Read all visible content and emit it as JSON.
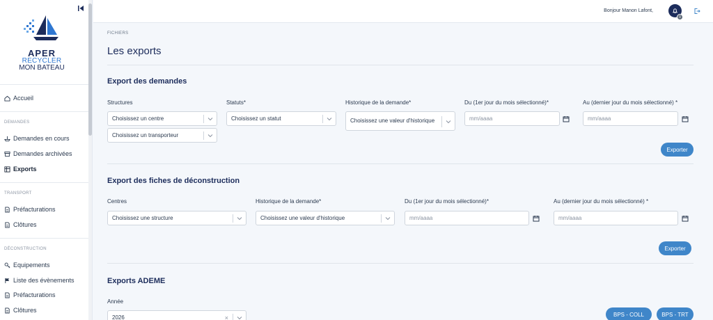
{
  "sidebar": {
    "brand": {
      "line1": "APER",
      "line2": "RECYCLER",
      "line3": "MON BATEAU"
    },
    "items": [
      {
        "label": "Accueil",
        "icon": "home-icon"
      },
      {
        "label": "Demandes en cours",
        "icon": "boat-icon"
      },
      {
        "label": "Demandes archivées",
        "icon": "archive-icon"
      },
      {
        "label": "Exports",
        "icon": "table-icon"
      },
      {
        "label": "Préfacturations",
        "icon": "document-icon"
      },
      {
        "label": "Clôtures",
        "icon": "document-icon"
      },
      {
        "label": "Equipements",
        "icon": "key-icon"
      },
      {
        "label": "Liste des évènements",
        "icon": "flag-icon"
      },
      {
        "label": "Préfacturations",
        "icon": "document-icon"
      },
      {
        "label": "Clôtures",
        "icon": "document-icon"
      }
    ],
    "sections": {
      "demandes": "DEMANDES",
      "transport": "TRANSPORT",
      "deconstruction": "DÉCONSTRUCTION"
    }
  },
  "header": {
    "greeting": "Bonjour Manon Lafont,",
    "notification_count": "0"
  },
  "page": {
    "breadcrumb": "FICHIERS",
    "title": "Les exports"
  },
  "export_demandes": {
    "title": "Export des demandes",
    "structures_label": "Structures",
    "centre_placeholder": "Choisissez un centre",
    "transporteur_placeholder": "Choisissez un transporteur",
    "statuts_label": "Statuts*",
    "statut_placeholder": "Choisissez un statut",
    "historique_label": "Historique de la demande*",
    "historique_placeholder": "Choisissez une valeur d'historique",
    "du_label": "Du (1er jour du mois sélectionné)*",
    "au_label": "Au (dernier jour du mois sélectionné) *",
    "date_placeholder": "mm/aaaa",
    "button": "Exporter"
  },
  "export_fiches": {
    "title": "Export des fiches de déconstruction",
    "centres_label": "Centres",
    "structure_placeholder": "Choisissez une structure",
    "historique_label": "Historique de la demande*",
    "historique_placeholder": "Choisissez une valeur d'historique",
    "du_label": "Du (1er jour du mois sélectionné)*",
    "au_label": "Au (dernier jour du mois sélectionné) *",
    "date_placeholder": "mm/aaaa",
    "button": "Exporter"
  },
  "export_ademe": {
    "title": "Exports ADEME",
    "annee_label": "Année",
    "annee_value": "2026",
    "btn_coll": "BPS - COLL",
    "btn_trt": "BPS - TRT"
  },
  "colors": {
    "primary": "#1c2c5b",
    "button": "#3f86c9",
    "background": "#f4f7fb"
  }
}
